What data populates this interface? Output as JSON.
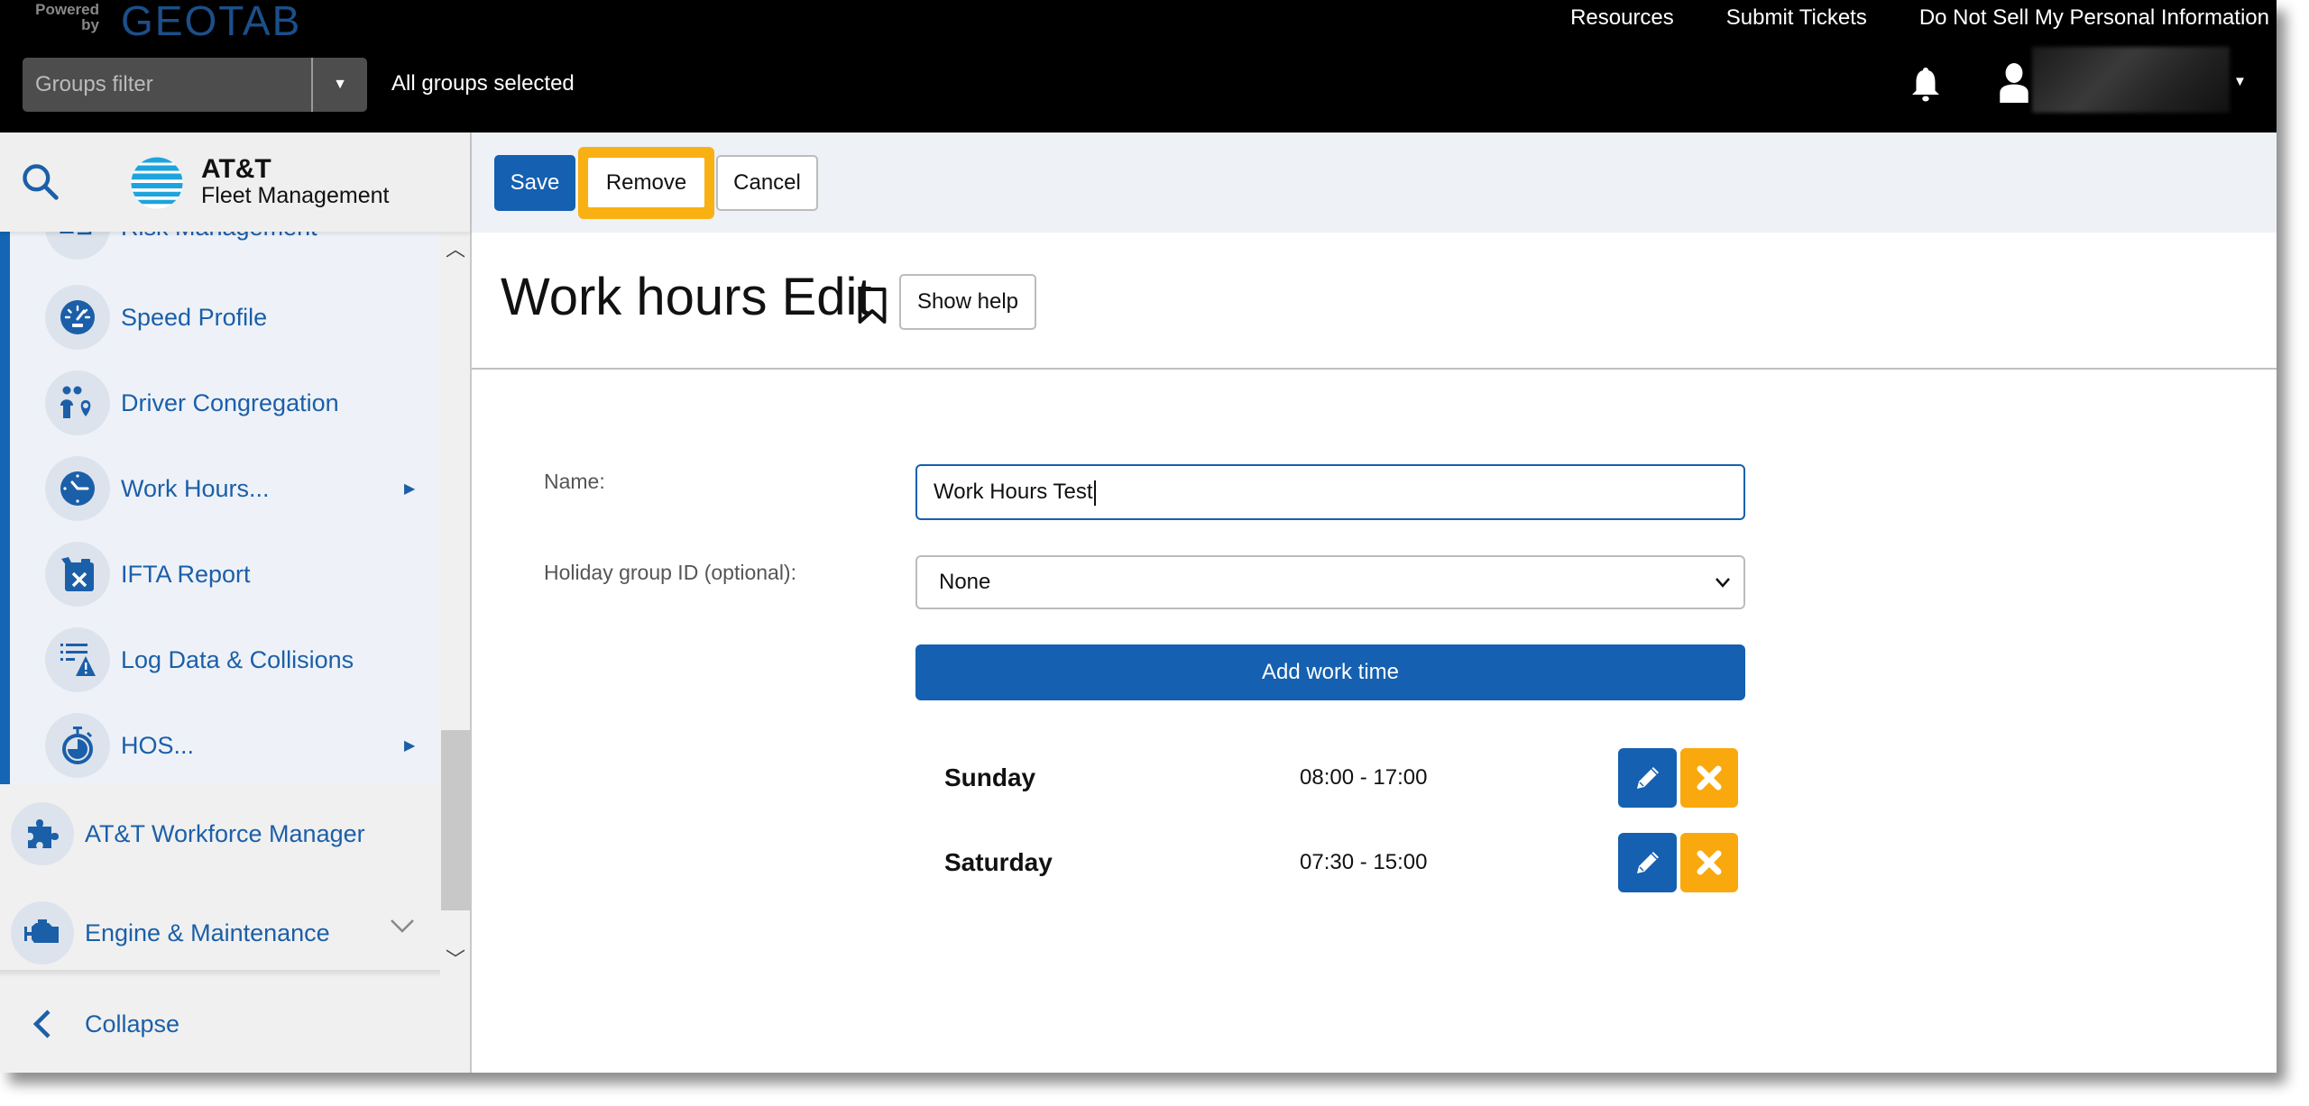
{
  "header": {
    "powered_by": "Powered by",
    "brand": "GEOTAB",
    "groups_filter_placeholder": "Groups filter",
    "groups_selected": "All groups selected",
    "links": [
      "Resources",
      "Submit Tickets",
      "Do Not Sell My Personal Information"
    ]
  },
  "sidebar": {
    "logo_line1": "AT&T",
    "logo_line2": "Fleet Management",
    "sub_items": [
      {
        "label": "Risk Management",
        "icon": "risk-icon",
        "has_submenu": false
      },
      {
        "label": "Speed Profile",
        "icon": "speedometer-icon",
        "has_submenu": false
      },
      {
        "label": "Driver Congregation",
        "icon": "driver-congregation-icon",
        "has_submenu": false
      },
      {
        "label": "Work Hours...",
        "icon": "clock-icon",
        "has_submenu": true
      },
      {
        "label": "IFTA Report",
        "icon": "fuel-can-icon",
        "has_submenu": false
      },
      {
        "label": "Log Data & Collisions",
        "icon": "log-collision-icon",
        "has_submenu": false
      },
      {
        "label": "HOS...",
        "icon": "stopwatch-icon",
        "has_submenu": true
      }
    ],
    "top_items": [
      {
        "label": "AT&T Workforce Manager",
        "icon": "puzzle-icon"
      },
      {
        "label": "Engine & Maintenance",
        "icon": "engine-icon"
      }
    ],
    "collapse_label": "Collapse"
  },
  "toolbar": {
    "save_label": "Save",
    "remove_label": "Remove",
    "cancel_label": "Cancel"
  },
  "page": {
    "title": "Work hours Edit",
    "show_help_label": "Show help"
  },
  "form": {
    "name_label": "Name:",
    "name_value": "Work Hours Test",
    "holiday_label": "Holiday group ID (optional):",
    "holiday_value": "None",
    "add_work_time_label": "Add work time",
    "work_times": [
      {
        "day": "Sunday",
        "time": "08:00 - 17:00"
      },
      {
        "day": "Saturday",
        "time": "07:30 - 15:00"
      }
    ]
  },
  "colors": {
    "primary": "#1560b0",
    "highlight": "#f9b012",
    "delete": "#f9a80d"
  }
}
